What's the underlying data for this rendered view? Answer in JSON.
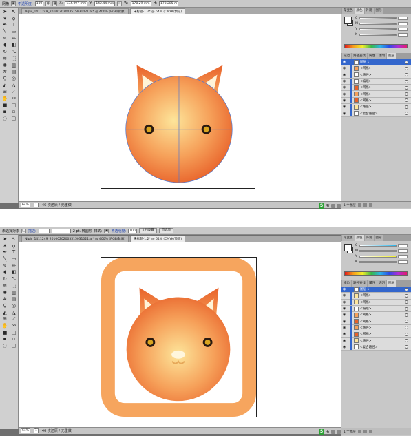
{
  "colors": {
    "ui_dark": "#6f6f6f",
    "panel_gray": "#c8c8c8",
    "layer_selected": "#3366cc",
    "cat_orange_dark": "#e8622a",
    "cat_orange_light": "#fde59a",
    "frame_orange": "#f6a55e",
    "guide_blue": "#5577cc"
  },
  "top": {
    "control_bar": {
      "mode_label": "网格",
      "opacity_label": "不透明度:",
      "opacity_value": "100",
      "x_value": "134.097 mm",
      "y_value": "142.44 mm",
      "w_value": "178.29 mm",
      "h_value": "178.285 m"
    },
    "tabs": [
      {
        "label": "Nipic_1411249_20100202003515031021.ai* @ 400% (RGB/轮廓)"
      },
      {
        "label": "未标题-1.2* @ 64% (CMYK/预览)"
      }
    ],
    "status": {
      "zoom": "64%",
      "page": "1",
      "info": "46 次还原 / 无重做"
    },
    "panel": {
      "color_tabs": [
        "渐变色",
        "颜色",
        "外观",
        "图形"
      ],
      "layer_tabs": [
        "描边",
        "路径查找",
        "属性",
        "透明",
        "图层"
      ],
      "layers": [
        {
          "name": "图层 1",
          "selected": true,
          "eye": true
        },
        {
          "name": "<网格>",
          "eye": true
        },
        {
          "name": "<路径>",
          "eye": true
        },
        {
          "name": "<编组>",
          "eye": true
        },
        {
          "name": "<网格>",
          "eye": true
        },
        {
          "name": "<网格>",
          "eye": true
        },
        {
          "name": "<网格>",
          "eye": true
        },
        {
          "name": "<路径>",
          "eye": true
        },
        {
          "name": "<复合路径>",
          "eye": true
        }
      ],
      "footer": "1 个图层"
    },
    "ime": {
      "text": "五"
    }
  },
  "bottom": {
    "control_bar": {
      "selection": "未选择对象",
      "stroke_label": "描边:",
      "stroke_value": "2 pt. 椭圆形",
      "style_label": "样式:",
      "opacity_label": "不透明度:",
      "opacity_value": "100",
      "doc_setup": "文档设置",
      "prefs": "首选项"
    },
    "tabs": [
      {
        "label": "Nipic_1411249_20100202003515031021.ai* @ 400% (RGB/轮廓)"
      },
      {
        "label": "未标题-1.2* @ 64% (CMYK/预览)"
      }
    ],
    "status": {
      "zoom": "64%",
      "page": "1",
      "info": "46 次还原 / 无重做"
    },
    "panel": {
      "color_tabs": [
        "渐变色",
        "颜色",
        "外观",
        "图形"
      ],
      "layer_tabs": [
        "描边",
        "路径查找",
        "属性",
        "透明",
        "图层"
      ],
      "layers": [
        {
          "name": "图层 1",
          "selected": true,
          "eye": true
        },
        {
          "name": "<网格>",
          "eye": true
        },
        {
          "name": "<网格>",
          "eye": true
        },
        {
          "name": "<编组>",
          "eye": true
        },
        {
          "name": "<网格>",
          "eye": true
        },
        {
          "name": "<网格>",
          "eye": true
        },
        {
          "name": "<路径>",
          "eye": true
        },
        {
          "name": "<网格>",
          "eye": true
        },
        {
          "name": "<路径>",
          "eye": true
        },
        {
          "name": "<复合路径>",
          "eye": true
        }
      ],
      "footer": "1 个图层"
    },
    "ime": {
      "text": "五"
    }
  }
}
